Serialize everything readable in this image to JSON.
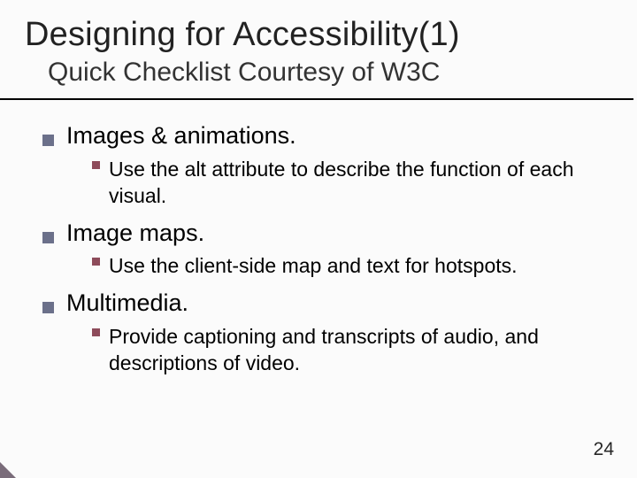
{
  "title": "Designing for Accessibility(1)",
  "subtitle": "Quick Checklist Courtesy of W3C",
  "items": [
    {
      "heading": "Images & animations.",
      "detail": "Use the alt attribute to describe the function of each visual."
    },
    {
      "heading": "Image maps.",
      "detail": "Use the client-side map and text for hotspots."
    },
    {
      "heading": "Multimedia.",
      "detail": "Provide captioning and transcripts of audio, and descriptions of video."
    }
  ],
  "page_number": "24"
}
